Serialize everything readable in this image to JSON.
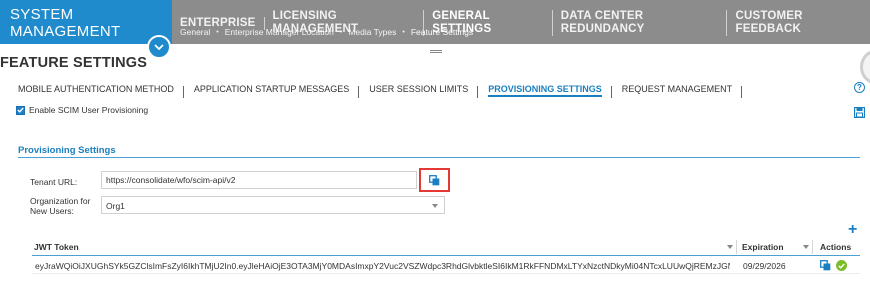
{
  "app": {
    "brand_line1": "SYSTEM",
    "brand_line2": "MANAGEMENT",
    "accent_color": "#1f8bcc",
    "topbar_color": "#8c8c8c"
  },
  "nav": {
    "items": [
      {
        "label": "ENTERPRISE"
      },
      {
        "label": "LICENSING MANAGEMENT"
      },
      {
        "label": "GENERAL SETTINGS"
      },
      {
        "label": "DATA CENTER REDUNDANCY"
      },
      {
        "label": "CUSTOMER FEEDBACK"
      }
    ],
    "subitems": [
      {
        "label": "General"
      },
      {
        "label": "Enterprise Manager Location"
      },
      {
        "label": "Media Types"
      },
      {
        "label": "Feature Settings"
      }
    ],
    "separator": "•"
  },
  "page": {
    "title": "FEATURE SETTINGS"
  },
  "tabs": [
    {
      "label": "MOBILE AUTHENTICATION METHOD"
    },
    {
      "label": "APPLICATION STARTUP MESSAGES"
    },
    {
      "label": "USER SESSION LIMITS"
    },
    {
      "label": "PROVISIONING SETTINGS"
    },
    {
      "label": "REQUEST MANAGEMENT"
    }
  ],
  "icons": {
    "help": "help-icon",
    "help_glyph": "?",
    "save": "save-icon",
    "copy": "copy-icon",
    "add": "add-icon",
    "add_glyph": "+",
    "approve": "check-circle-icon"
  },
  "scim": {
    "label": "Enable SCIM User Provisioning",
    "checked": true
  },
  "provisioning": {
    "section_title": "Provisioning Settings",
    "tenant_label": "Tenant URL:",
    "tenant_value": "https://consolidate/wfo/scim-api/v2",
    "org_label_line1": "Organization for",
    "org_label_line2": "New Users:",
    "org_value": "Org1"
  },
  "grid": {
    "columns": {
      "token": "JWT Token",
      "expiration": "Expiration",
      "actions": "Actions"
    },
    "rows": [
      {
        "token": "eyJraWQiOiJXUGhSYk5GZClsImFsZyI6IkhTMjU2In0.eyJleHAiOjE3OTA3MjY0MDAsImxpY2Vuc2VSZWdpc3RhdGlvbktleSI6IkM1RkFFNDMxLTYxNzctNDkyMi04NTcxLUUwQjREMzJGNz...",
        "expiration": "09/29/2026"
      }
    ]
  }
}
